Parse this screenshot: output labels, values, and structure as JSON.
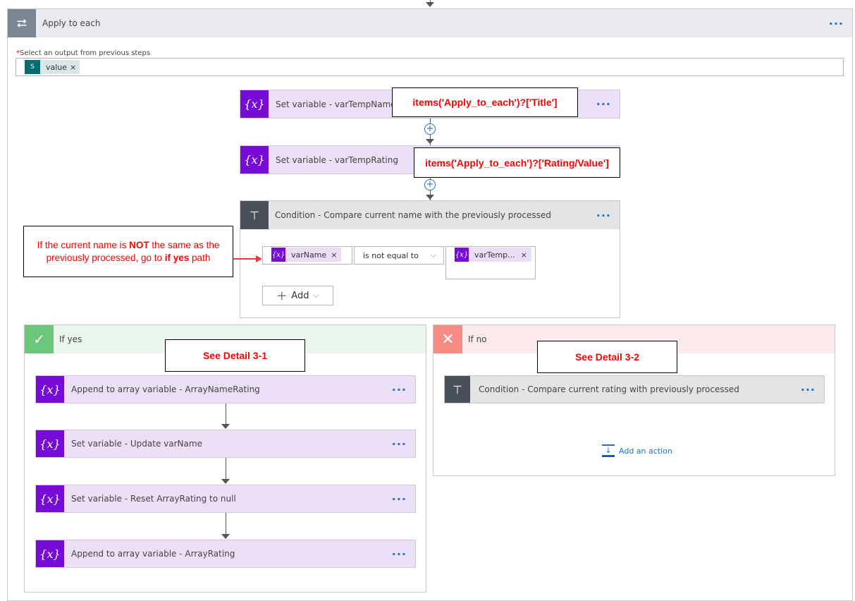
{
  "loop": {
    "title": "Apply to each",
    "required_mark": "*",
    "field_label": "Select an output from previous steps",
    "token": "value",
    "token_remove": "×",
    "menu": "···"
  },
  "actions": [
    {
      "title": "Set variable - varTempName",
      "menu": "···"
    },
    {
      "title": "Set variable - varTempRating",
      "menu": "···"
    }
  ],
  "condition": {
    "title": "Condition - Compare current name with the previously processed",
    "menu": "···",
    "left_token": "varName",
    "operator": "is not equal to",
    "right_token": "varTemp...",
    "remove": "×",
    "add_label": "Add"
  },
  "annotations": {
    "note1": "items('Apply_to_each')?['Title']",
    "note2": "items('Apply_to_each')?['Rating/Value']",
    "note3_a": "If the current name is ",
    "note3_b": "NOT",
    "note3_c": " the same as the previously processed, go to ",
    "note3_d": "if yes",
    "note3_e": " path",
    "detail1": "See Detail 3-1",
    "detail2": "See Detail 3-2"
  },
  "if_yes": {
    "title": "If yes",
    "actions": [
      {
        "title": "Append to array variable - ArrayNameRating",
        "menu": "···"
      },
      {
        "title": "Set variable - Update varName",
        "menu": "···"
      },
      {
        "title": "Set variable - Reset ArrayRating to null",
        "menu": "···"
      },
      {
        "title": "Append to array variable - ArrayRating",
        "menu": "···"
      }
    ]
  },
  "if_no": {
    "title": "If no",
    "condition": "Condition - Compare current rating with previously processed",
    "menu": "···",
    "add_action": "Add an action"
  },
  "colors": {
    "variable": "#770bd6",
    "condition": "#484f58",
    "yes": "#6cc77a",
    "no": "#f98b85",
    "link": "#1a73c9",
    "annotation": "#ff0000"
  }
}
